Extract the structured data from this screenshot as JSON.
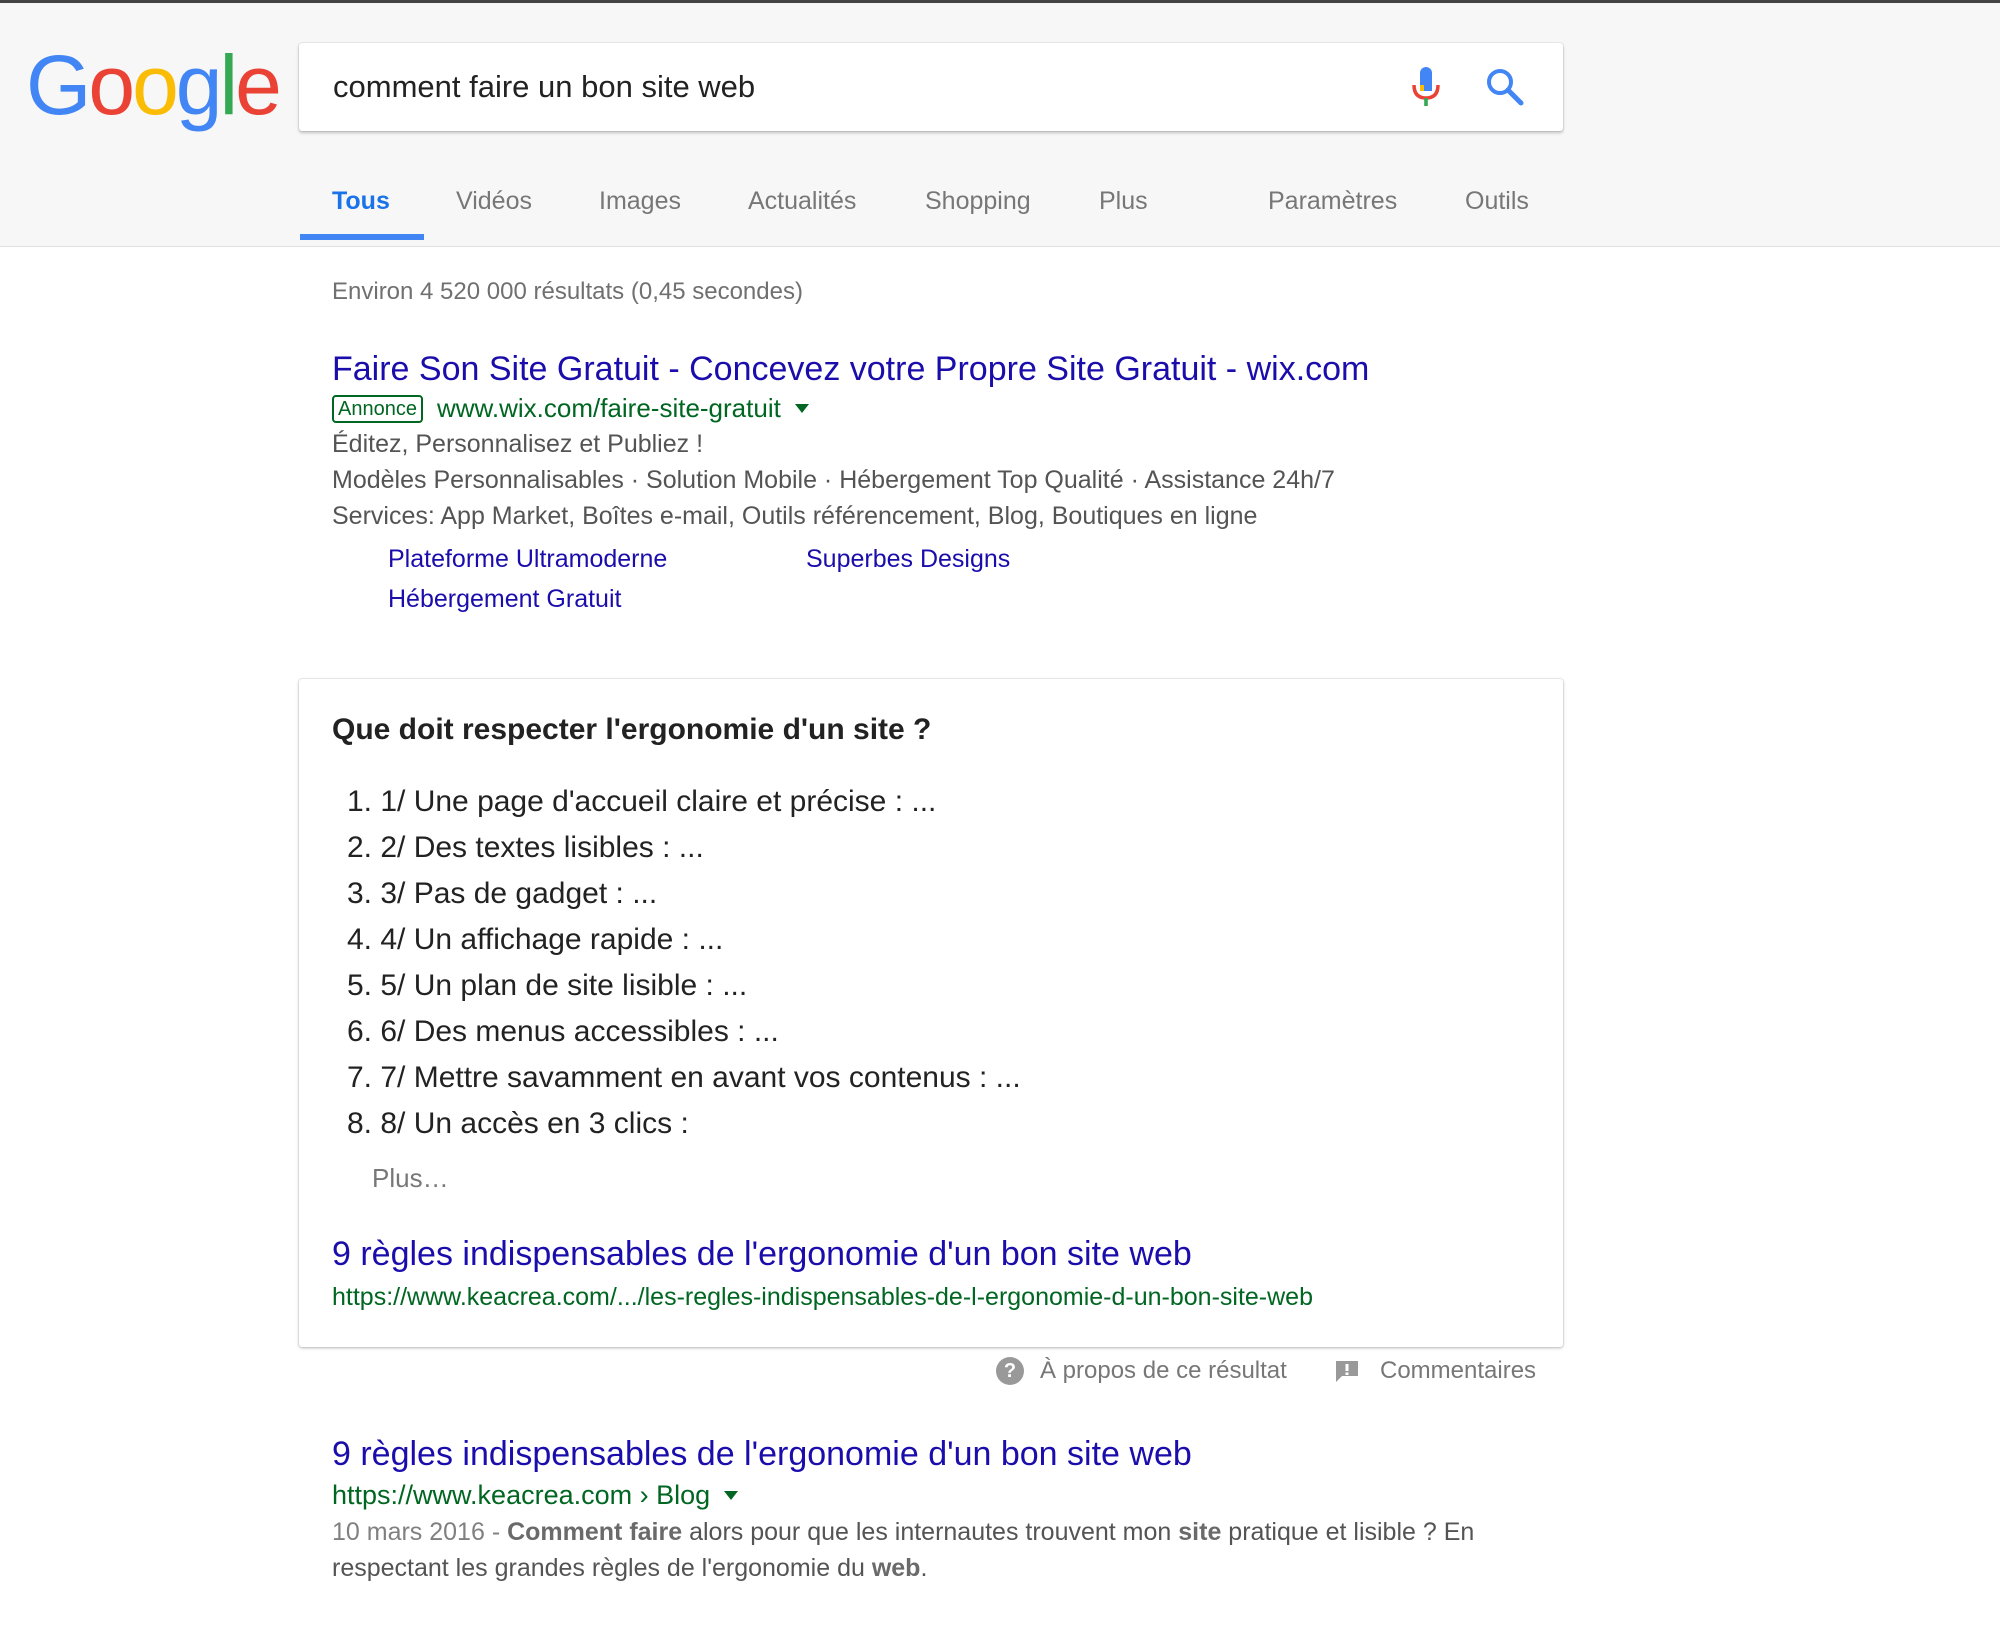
{
  "logo": {
    "letters": [
      "G",
      "o",
      "o",
      "g",
      "l",
      "e"
    ],
    "colors": [
      "#4285F4",
      "#EA4335",
      "#FBBC05",
      "#4285F4",
      "#34A853",
      "#EA4335"
    ]
  },
  "search": {
    "query": "comment faire un bon site web",
    "icons": [
      "mic-icon",
      "search-icon"
    ]
  },
  "tabs": [
    {
      "label": "Tous",
      "active": true
    },
    {
      "label": "Vidéos"
    },
    {
      "label": "Images"
    },
    {
      "label": "Actualités"
    },
    {
      "label": "Shopping"
    },
    {
      "label": "Plus"
    },
    {
      "label": "Paramètres"
    },
    {
      "label": "Outils"
    }
  ],
  "stats": "Environ 4 520 000 résultats (0,45 secondes)",
  "ad": {
    "title": "Faire Son Site Gratuit - Concevez votre Propre Site Gratuit - wix.com",
    "badge": "Annonce",
    "url": "www.wix.com/faire-site-gratuit",
    "lines": [
      "Éditez, Personnalisez et Publiez !",
      "Modèles Personnalisables · Solution Mobile · Hébergement Top Qualité · Assistance 24h/7",
      "Services: App Market, Boîtes e-mail, Outils référencement, Blog, Boutiques en ligne"
    ],
    "sitelinks": [
      "Plateforme Ultramoderne",
      "Superbes Designs",
      "Hébergement Gratuit"
    ]
  },
  "snippet": {
    "question": "Que doit respecter l'ergonomie d'un site ?",
    "items": [
      {
        "num": "1.",
        "text": "1/ Une page d'accueil claire et précise : ..."
      },
      {
        "num": "2.",
        "text": "2/ Des textes lisibles : ..."
      },
      {
        "num": "3.",
        "text": "3/ Pas de gadget : ..."
      },
      {
        "num": "4.",
        "text": "4/ Un affichage rapide : ..."
      },
      {
        "num": "5.",
        "text": "5/ Un plan de site lisible : ..."
      },
      {
        "num": "6.",
        "text": "6/ Des menus accessibles : ..."
      },
      {
        "num": "7.",
        "text": "7/ Mettre savamment en avant vos contenus : ..."
      },
      {
        "num": "8.",
        "text": "8/ Un accès en 3 clics :"
      }
    ],
    "more": "Plus…",
    "link_title": "9 règles indispensables de l'ergonomie d'un bon site web",
    "link_url": "https://www.keacrea.com/.../les-regles-indispensables-de-l-ergonomie-d-un-bon-site-web"
  },
  "feedback": {
    "about": "À propos de ce résultat",
    "comments": "Commentaires"
  },
  "result2": {
    "title": "9 règles indispensables de l'ergonomie d'un bon site web",
    "url": "https://www.keacrea.com › Blog",
    "date": "10 mars 2016 - ",
    "desc_parts": [
      {
        "t": "Comment faire",
        "b": true
      },
      {
        "t": " alors pour que les internautes trouvent mon ",
        "b": false
      },
      {
        "t": "site",
        "b": true
      },
      {
        "t": " pratique et lisible ? En respectant les grandes règles de l'ergonomie du ",
        "b": false
      },
      {
        "t": "web",
        "b": true
      },
      {
        "t": ".",
        "b": false
      }
    ]
  }
}
